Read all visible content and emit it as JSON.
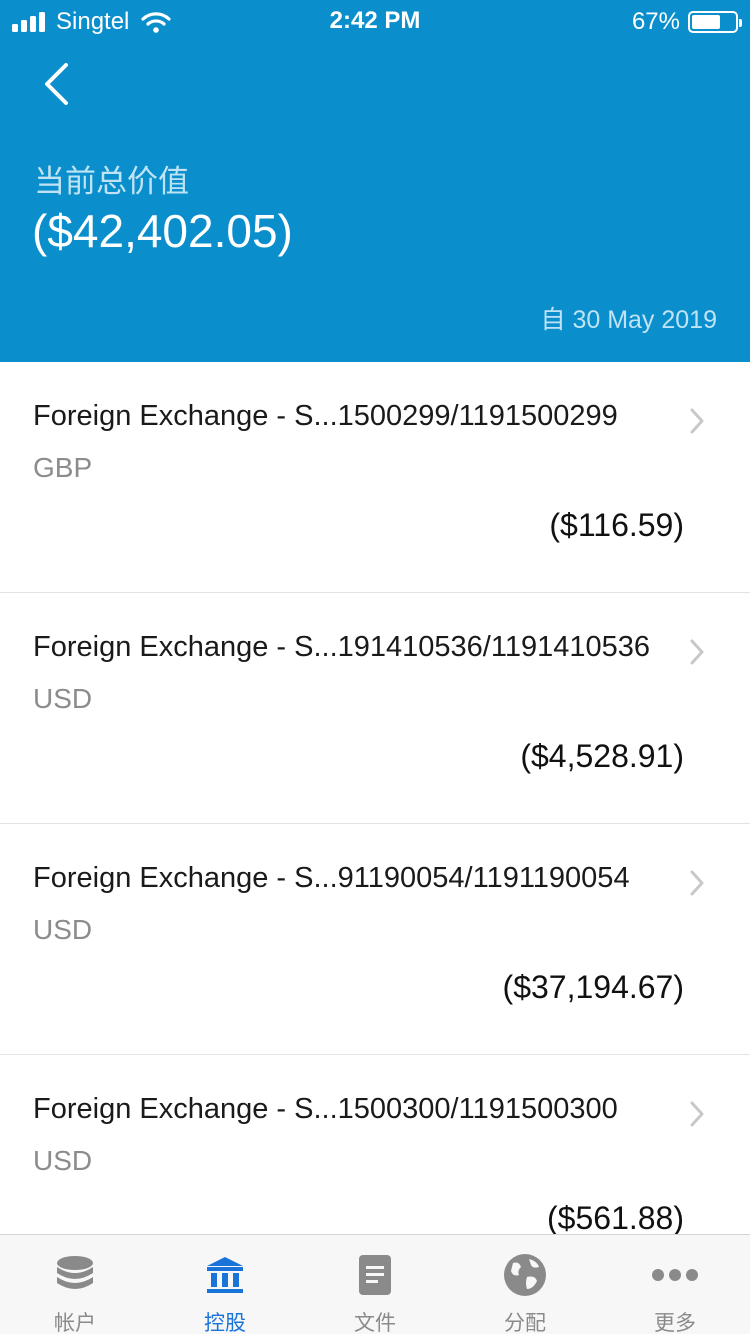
{
  "status_bar": {
    "carrier": "Singtel",
    "time": "2:42 PM",
    "battery_percent": "67%",
    "battery_level": 0.67
  },
  "header": {
    "title": "当前总价值",
    "total": "($42,402.05)",
    "as_of": "自 30 May 2019",
    "back_icon": "chevron-left-icon"
  },
  "holdings": [
    {
      "title": "Foreign Exchange - S...1500299/1191500299",
      "currency": "GBP",
      "amount": "($116.59)"
    },
    {
      "title": "Foreign Exchange - S...191410536/1191410536",
      "currency": "USD",
      "amount": "($4,528.91)"
    },
    {
      "title": "Foreign Exchange - S...91190054/1191190054",
      "currency": "USD",
      "amount": "($37,194.67)"
    },
    {
      "title": "Foreign Exchange - S...1500300/1191500300",
      "currency": "USD",
      "amount": "($561.88)"
    }
  ],
  "tabs": [
    {
      "label": "帐户",
      "icon": "database-icon",
      "active": false
    },
    {
      "label": "控股",
      "icon": "bank-icon",
      "active": true
    },
    {
      "label": "文件",
      "icon": "document-icon",
      "active": false
    },
    {
      "label": "分配",
      "icon": "globe-icon",
      "active": false
    },
    {
      "label": "更多",
      "icon": "more-icon",
      "active": false
    }
  ],
  "colors": {
    "header_bg": "#0a8fcc",
    "active_tab": "#1a73d9",
    "inactive_tab": "#8a8a8a"
  }
}
